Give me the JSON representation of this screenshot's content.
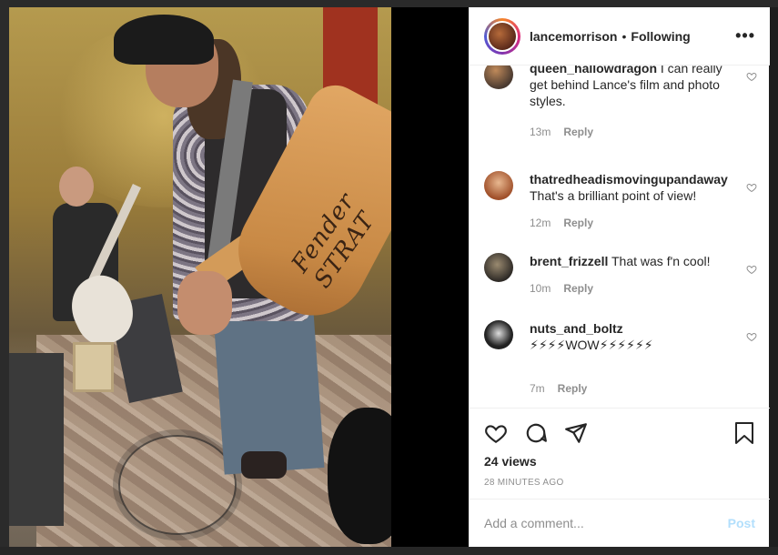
{
  "post": {
    "username": "lancemorrison",
    "separator": "•",
    "follow_status": "Following",
    "more_icon": "•••",
    "guitar_text": "Fender STRAT"
  },
  "comments": [
    {
      "username": "queen_hallowdragon",
      "text": "I can really get behind Lance's film and photo styles.",
      "time": "13m",
      "reply": "Reply"
    },
    {
      "username": "thatredheadismovingupandaway",
      "text": "That's a brilliant point of view!",
      "time": "12m",
      "reply": "Reply"
    },
    {
      "username": "brent_frizzell",
      "text": "That was f'n cool!",
      "time": "10m",
      "reply": "Reply"
    },
    {
      "username": "nuts_and_boltz",
      "text": "⚡⚡⚡⚡WOW⚡⚡⚡⚡⚡⚡",
      "time": "7m",
      "reply": "Reply"
    }
  ],
  "stats": {
    "views": "24 views",
    "time_ago": "28 MINUTES AGO"
  },
  "comment_box": {
    "placeholder": "Add a comment...",
    "post_label": "Post"
  },
  "colors": {
    "text": "#262626",
    "muted": "#8e8e8e",
    "post_disabled": "#b2dffc"
  }
}
